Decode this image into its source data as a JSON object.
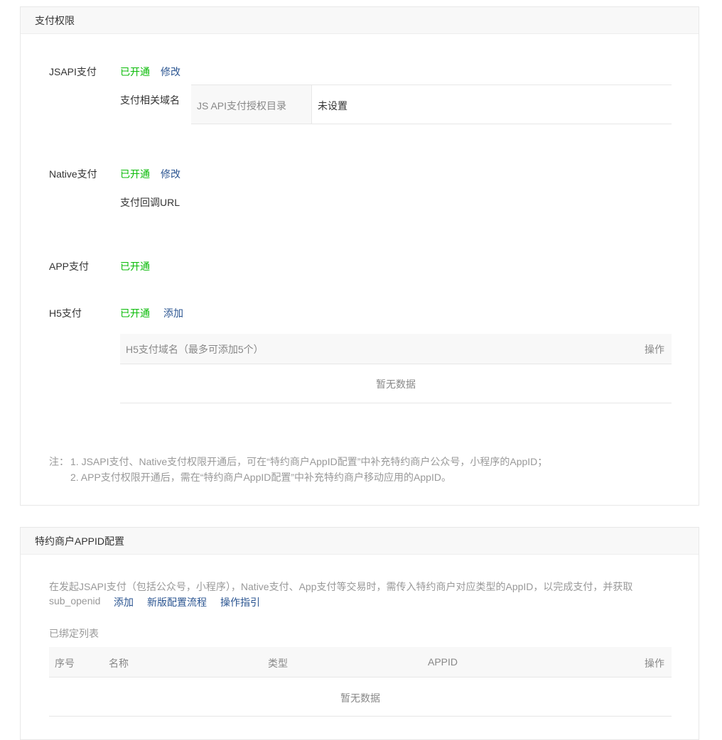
{
  "section1": {
    "title": "支付权限",
    "jsapi": {
      "label": "JSAPI支付",
      "status": "已开通",
      "action": "修改",
      "domain_label": "支付相关域名",
      "table_header": "JS API支付授权目录",
      "table_value": "未设置"
    },
    "native": {
      "label": "Native支付",
      "status": "已开通",
      "action": "修改",
      "callback_label": "支付回调URL"
    },
    "app": {
      "label": "APP支付",
      "status": "已开通"
    },
    "h5": {
      "label": "H5支付",
      "status": "已开通",
      "action": "添加",
      "col_domain": "H5支付域名（最多可添加5个）",
      "col_op": "操作",
      "empty": "暂无数据"
    },
    "note_prefix": "注：",
    "note1": "1. JSAPI支付、Native支付权限开通后，可在“特约商户AppID配置”中补充特约商户公众号，小程序的AppID；",
    "note2": "2. APP支付权限开通后，需在“特约商户AppID配置”中补充特约商户移动应用的AppID。"
  },
  "section2": {
    "title": "特约商户APPID配置",
    "desc_line1": "在发起JSAPI支付（包括公众号，小程序），Native支付、App支付等交易时，需传入特约商户对应类型的AppID，以完成支付，并获取",
    "desc_line2": "sub_openid",
    "link_add": "添加",
    "link_flow": "新版配置流程",
    "link_guide": "操作指引",
    "list_title": "已绑定列表",
    "columns": {
      "index": "序号",
      "name": "名称",
      "type": "类型",
      "appid": "APPID",
      "op": "操作"
    },
    "empty": "暂无数据"
  },
  "colors": {
    "status_green": "#09bb07",
    "link_blue": "#2b5591"
  }
}
